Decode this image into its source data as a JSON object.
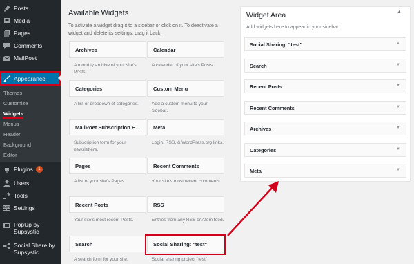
{
  "sidebar": {
    "items": [
      {
        "label": "Posts",
        "icon": "pin-icon"
      },
      {
        "label": "Media",
        "icon": "media-icon"
      },
      {
        "label": "Pages",
        "icon": "pages-icon"
      },
      {
        "label": "Comments",
        "icon": "comments-icon"
      },
      {
        "label": "MailPoet",
        "icon": "mailpoet-icon"
      },
      {
        "label": "Appearance",
        "icon": "brush-icon"
      }
    ],
    "submenu": [
      "Themes",
      "Customize",
      "Widgets",
      "Menus",
      "Header",
      "Background",
      "Editor"
    ],
    "lower_items": [
      {
        "label": "Plugins",
        "icon": "plugin-icon",
        "badge": "1"
      },
      {
        "label": "Users",
        "icon": "users-icon"
      },
      {
        "label": "Tools",
        "icon": "tools-icon"
      },
      {
        "label": "Settings",
        "icon": "settings-icon"
      },
      {
        "label": "PopUp by Supsystic",
        "icon": "popup-icon"
      },
      {
        "label": "Social Share by Supsystic",
        "icon": "share-icon"
      }
    ]
  },
  "available": {
    "title": "Available Widgets",
    "description": "To activate a widget drag it to a sidebar or click on it. To deactivate a widget and delete its settings, drag it back.",
    "widgets": [
      {
        "name": "Archives",
        "desc": "A monthly archive of your site's Posts."
      },
      {
        "name": "Calendar",
        "desc": "A calendar of your site's Posts."
      },
      {
        "name": "Categories",
        "desc": "A list or dropdown of categories."
      },
      {
        "name": "Custom Menu",
        "desc": "Add a custom menu to your sidebar."
      },
      {
        "name": "MailPoet Subscription F...",
        "desc": "Subscription form for your newsletters."
      },
      {
        "name": "Meta",
        "desc": "Login, RSS, & WordPress.org links."
      },
      {
        "name": "Pages",
        "desc": "A list of your site's Pages."
      },
      {
        "name": "Recent Comments",
        "desc": "Your site's most recent comments."
      },
      {
        "name": "Recent Posts",
        "desc": "Your site's most recent Posts."
      },
      {
        "name": "RSS",
        "desc": "Entries from any RSS or Atom feed."
      },
      {
        "name": "Search",
        "desc": "A search form for your site."
      },
      {
        "name": "Social Sharing: \"test\"",
        "desc": "Social sharing project \"test\""
      }
    ]
  },
  "widget_area": {
    "title": "Widget Area",
    "description": "Add widgets here to appear in your sidebar.",
    "widgets": [
      "Social Sharing: \"test\"",
      "Search",
      "Recent Posts",
      "Recent Comments",
      "Archives",
      "Categories",
      "Meta"
    ]
  },
  "colors": {
    "sidebar_bg": "#23282d",
    "accent": "#0073aa",
    "highlight": "#d0021b"
  }
}
